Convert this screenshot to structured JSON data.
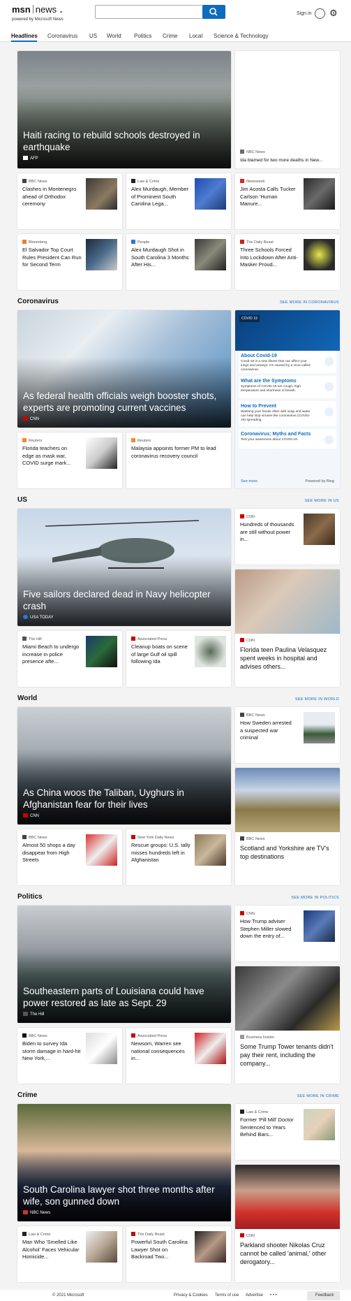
{
  "header": {
    "logo_brand": "msn",
    "logo_section": "news",
    "powered": "powered by Microsoft News",
    "signin": "Sign in"
  },
  "nav": [
    "Headlines",
    "Coronavirus",
    "US",
    "World",
    "Politics",
    "Crime",
    "Local",
    "Science & Technology"
  ],
  "top": {
    "hero": {
      "title": "Haiti racing to rebuild schools destroyed in earthquake",
      "source": "AFP"
    },
    "side": {
      "source": "NBC News",
      "title": "Ida blamed for two more deaths in New..."
    },
    "small": [
      {
        "source": "BBC News",
        "title": "Clashes in Montenegro ahead of Orthodox ceremony"
      },
      {
        "source": "Law & Crime",
        "title": "Alex Murdaugh, Member of Prominent South Carolina Lega..."
      },
      {
        "source": "Newsweek",
        "title": "Jim Acosta Calls Tucker Carlson 'Human Manure..."
      },
      {
        "source": "Bloomberg",
        "title": "El Salvador Top Court Rules President Can Run for Second Term"
      },
      {
        "source": "People",
        "title": "Alex Murdaugh Shot in South Carolina 3 Months After His..."
      },
      {
        "source": "The Daily Beast",
        "title": "Three Schools Forced Into Lockdown After Anti-Masker Proud..."
      }
    ]
  },
  "sections": [
    {
      "name": "Coronavirus",
      "more": "SEE MORE IN CORONAVIRUS"
    },
    {
      "name": "US",
      "more": "SEE MORE IN US"
    },
    {
      "name": "World",
      "more": "SEE MORE IN WORLD"
    },
    {
      "name": "Politics",
      "more": "SEE MORE IN POLITICS"
    },
    {
      "name": "Crime",
      "more": "SEE MORE IN CRIME"
    }
  ],
  "corona": {
    "hero": {
      "title": "As federal health officials weigh booster shots, experts are promoting current vaccines",
      "source": "CNN"
    },
    "small": [
      {
        "source": "Reuters",
        "title": "Florida teachers on edge as mask war, COVID surge mark..."
      },
      {
        "source": "Reuters",
        "title": "Malaysia appoints former PM to lead coronavirus recovery council"
      }
    ],
    "panel": {
      "badge": "COVID 19",
      "items": [
        {
          "h": "About Covid-19",
          "d": "Covid-19 is a new illness that can affect your lungs and airways. It's caused by a virus called coronavirus."
        },
        {
          "h": "What are the Symptoms",
          "d": "Symptoms of COVID-19 are cough, high temperature and shortness of breath."
        },
        {
          "h": "How to Prevent",
          "d": "Washing your hands often with soap and water can help stop viruses like coronavirus (COVID-19) spreading."
        },
        {
          "h": "Coronavirus: Myths and Facts",
          "d": "Test your awareness about COVID-19."
        }
      ],
      "see_more": "See more",
      "powered": "Powered by Bing"
    }
  },
  "us": {
    "hero": {
      "title": "Five sailors declared dead in Navy helicopter crash",
      "source": "USA TODAY"
    },
    "side": {
      "source": "CNN",
      "title": "Hundreds of thousands are still without power in..."
    },
    "small": [
      {
        "source": "The Hill",
        "title": "Miami Beach to undergo increase in police presence afte..."
      },
      {
        "source": "Associated Press",
        "title": "Cleanup boats on scene of large Gulf oil spill following Ida"
      }
    ],
    "big": {
      "source": "CNN",
      "title": "Florida teen Paulina Velasquez spent weeks in hospital and advises others..."
    }
  },
  "world": {
    "hero": {
      "title": "As China woos the Taliban, Uyghurs in Afghanistan fear for their lives",
      "source": "CNN"
    },
    "side": {
      "source": "BBC News",
      "title": "How Sweden arrested a suspected war criminal"
    },
    "small": [
      {
        "source": "BBC News",
        "title": "Almost 50 shops a day disappear from High Streets"
      },
      {
        "source": "New York Daily News",
        "title": "Rescue groups: U.S. tally misses hundreds left in Afghanistan"
      }
    ],
    "big": {
      "source": "BBC News",
      "title": "Scotland and Yorkshire are TV's top destinations"
    }
  },
  "politics": {
    "hero": {
      "title": "Southeastern parts of Louisiana could have power restored as late as Sept. 29",
      "source": "The Hill"
    },
    "side": {
      "source": "CNN",
      "title": "How Trump adviser Stephen Miller slowed down the entry of..."
    },
    "small": [
      {
        "source": "ABC News",
        "title": "Biden to survey Ida storm damage in hard-hit New York,..."
      },
      {
        "source": "Associated Press",
        "title": "Newsom, Warren see national consequences in..."
      }
    ],
    "big": {
      "source": "Business Insider",
      "title": "Some Trump Tower tenants didn't pay their rent, including the company..."
    }
  },
  "crime": {
    "hero": {
      "title": "South Carolina lawyer shot three months after wife, son gunned down",
      "source": "NBC News"
    },
    "side": {
      "source": "Law & Crime",
      "title": "Former 'Pill Mill' Doctor Sentenced to Years Behind Bars..."
    },
    "small": [
      {
        "source": "Law & Crime",
        "title": "Man Who 'Smelled Like Alcohol' Faces Vehicular Homicide..."
      },
      {
        "source": "The Daily Beast",
        "title": "Powerful South Carolina Lawyer Shot on Backroad Two..."
      }
    ],
    "big": {
      "source": "CNN",
      "title": "Parkland shooter Nikolas Cruz cannot be called 'animal,' other derogatory..."
    }
  },
  "footer": {
    "copyright": "© 2021 Microsoft",
    "privacy": "Privacy & Cookies",
    "terms": "Terms of use",
    "advertise": "Advertise",
    "more": "• • •",
    "feedback": "Feedback"
  }
}
